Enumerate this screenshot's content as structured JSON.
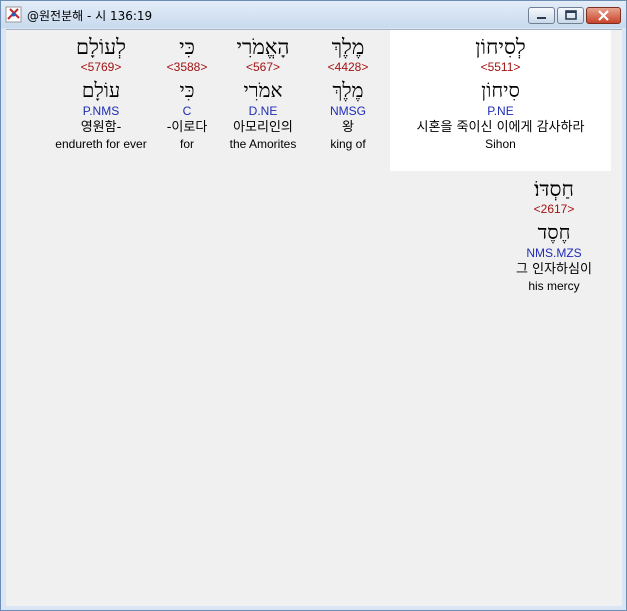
{
  "window": {
    "title": "@원전분해 - 시 136:19",
    "icon": "app-icon",
    "buttons": {
      "minimize": "minimize-icon",
      "maximize": "maximize-icon",
      "close": "close-icon"
    }
  },
  "words": [
    {
      "hebrew": "לְעוֹלָם",
      "strong": "<5769>",
      "lemma": "עוֹלָם",
      "morph": "P.NMS",
      "korean": "영원함-",
      "english": "endureth for ever"
    },
    {
      "hebrew": "כִּי",
      "strong": "<3588>",
      "lemma": "כִּי",
      "morph": "C",
      "korean": "-이로다",
      "english": "for"
    },
    {
      "hebrew": "הָאֱמֹרִי",
      "strong": "<567>",
      "lemma": "אמֹרִי",
      "morph": "D.NE",
      "korean": "아모리인의",
      "english": "the Amorites"
    },
    {
      "hebrew": "מֶלֶךְ",
      "strong": "<4428>",
      "lemma": "מֶלֶךְ",
      "morph": "NMSG",
      "korean": "왕",
      "english": "king of"
    },
    {
      "hebrew": "לְסִיחוֹן",
      "strong": "<5511>",
      "lemma": "סִיחוֹן",
      "morph": "P.NE",
      "korean": "시혼을 죽이신 이에게 감사하라",
      "english": "Sihon"
    },
    {
      "hebrew": "חַסְדּוֹ׃",
      "strong": "<2617>",
      "lemma": "חֶסֶד",
      "morph": "NMS.MZS",
      "korean": "그 인자하심이",
      "english": "his mercy"
    }
  ],
  "colors": {
    "strong": "#a21313",
    "morph": "#1e2db5",
    "highlight": "#ffffff"
  }
}
